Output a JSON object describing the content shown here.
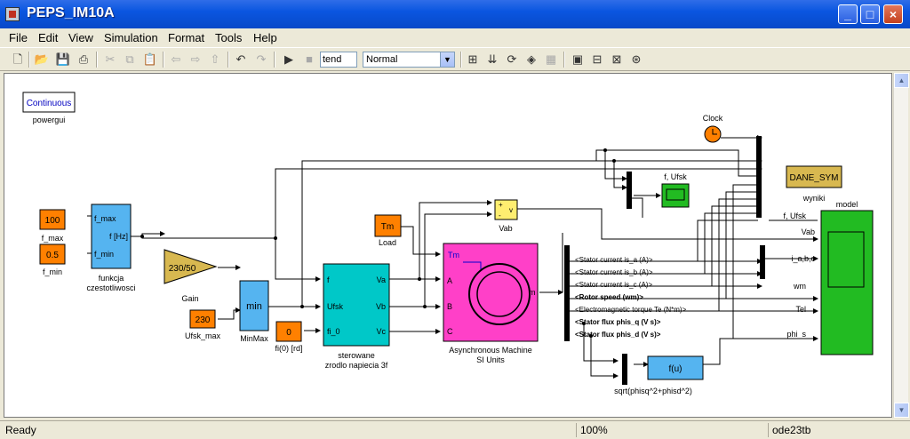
{
  "window": {
    "title": "PEPS_IM10A"
  },
  "menu": [
    "File",
    "Edit",
    "View",
    "Simulation",
    "Format",
    "Tools",
    "Help"
  ],
  "toolbar": {
    "stop_time": "tend",
    "mode": "Normal"
  },
  "blocks": {
    "powergui": {
      "text": "Continuous",
      "label": "powergui"
    },
    "clock": "Clock",
    "fmax": {
      "value": "100",
      "label": "f_max"
    },
    "fmin": {
      "value": "0.5",
      "label": "f_min"
    },
    "func": {
      "in1": "f_max",
      "in2": "f_min",
      "out": "f [Hz]",
      "label1": "funkcja",
      "label2": "czestotliwosci"
    },
    "gain": {
      "value": "230/50",
      "label": "Gain"
    },
    "ufsk": {
      "value": "230",
      "label": "Ufsk_max"
    },
    "minmax": {
      "text": "min",
      "label": "MinMax"
    },
    "load": {
      "value": "Tm",
      "label": "Load"
    },
    "fi0": {
      "value": "0",
      "label": "fi(0) [rd]"
    },
    "source": {
      "in1": "f",
      "in2": "Ufsk",
      "in3": "fi_0",
      "out1": "Va",
      "out2": "Vb",
      "out3": "Vc",
      "label1": "sterowane",
      "label2": "zrodlo napiecia 3f"
    },
    "vab": {
      "plus": "+",
      "minus": "-",
      "v": "v",
      "label": "Vab"
    },
    "machine": {
      "tm": "Tm",
      "a": "A",
      "b": "B",
      "c": "C",
      "m": "m",
      "label1": "Asynchronous Machine",
      "label2": "SI Units"
    },
    "scope": {
      "label": "f, Ufsk"
    },
    "dane": {
      "text": "DANE_SYM",
      "label": "wyniki"
    },
    "model": {
      "label": "model"
    },
    "fcn": {
      "text": "f(u)",
      "label": "sqrt(phisq^2+phisd^2)"
    },
    "signals": [
      "<Stator current is_a (A)>",
      "<Stator current is_b (A)>",
      "<Stator current is_c (A)>",
      "<Rotor speed (wm)>",
      "<Electromagnetic torque Te (N*m)>",
      "<Stator flux phis_q (V s)>",
      "<Stator flux phis_d (V s)>"
    ],
    "model_inputs": [
      "f, Ufsk",
      "Vab",
      "i_a,b,c",
      "wm",
      "Tel",
      "phi_s"
    ]
  },
  "status": {
    "left": "Ready",
    "zoom": "100%",
    "solver": "ode23tb"
  },
  "colors": {
    "title_bar": "#0a56e0",
    "orange": "#ff8000",
    "light_blue": "#55b4f0",
    "cyan": "#00c8c8",
    "magenta": "#ff40c8",
    "green": "#22bb22",
    "gold": "#d8b850",
    "yellow": "#ffee70"
  }
}
